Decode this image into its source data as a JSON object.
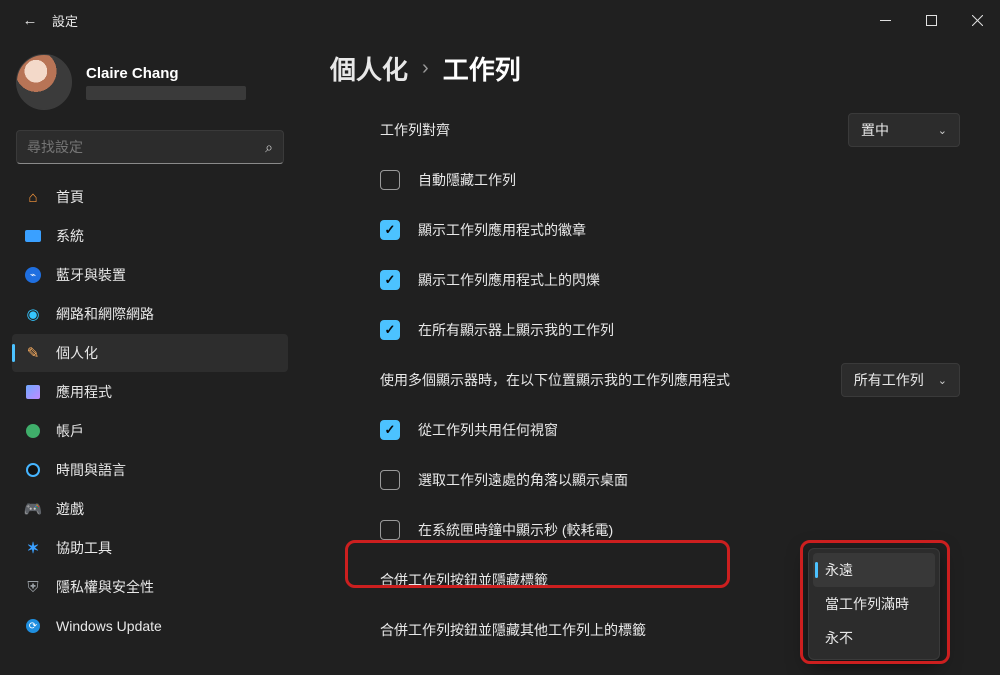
{
  "titlebar": {
    "title": "設定"
  },
  "user": {
    "name": "Claire Chang"
  },
  "search": {
    "placeholder": "尋找設定"
  },
  "nav": {
    "items": [
      {
        "label": "首頁"
      },
      {
        "label": "系統"
      },
      {
        "label": "藍牙與裝置"
      },
      {
        "label": "網路和網際網路"
      },
      {
        "label": "個人化"
      },
      {
        "label": "應用程式"
      },
      {
        "label": "帳戶"
      },
      {
        "label": "時間與語言"
      },
      {
        "label": "遊戲"
      },
      {
        "label": "協助工具"
      },
      {
        "label": "隱私權與安全性"
      },
      {
        "label": "Windows Update"
      }
    ]
  },
  "crumb": {
    "a": "個人化",
    "b": "工作列"
  },
  "rows": {
    "align": {
      "label": "工作列對齊",
      "value": "置中"
    },
    "autohide": {
      "label": "自動隱藏工作列",
      "checked": false
    },
    "badges": {
      "label": "顯示工作列應用程式的徽章",
      "checked": true
    },
    "flash": {
      "label": "顯示工作列應用程式上的閃爍",
      "checked": true
    },
    "alldisplays": {
      "label": "在所有顯示器上顯示我的工作列",
      "checked": true
    },
    "multidisplay": {
      "label": "使用多個顯示器時，在以下位置顯示我的工作列應用程式",
      "value": "所有工作列"
    },
    "share": {
      "label": "從工作列共用任何視窗",
      "checked": true
    },
    "farcorner": {
      "label": "選取工作列遠處的角落以顯示桌面",
      "checked": false
    },
    "seconds": {
      "label": "在系統匣時鐘中顯示秒 (較耗電)",
      "checked": false
    },
    "combine": {
      "label": "合併工作列按鈕並隱藏標籤"
    },
    "combine_other": {
      "label": "合併工作列按鈕並隱藏其他工作列上的標籤"
    }
  },
  "menu": {
    "items": [
      {
        "label": "永遠"
      },
      {
        "label": "當工作列滿時"
      },
      {
        "label": "永不"
      }
    ]
  }
}
